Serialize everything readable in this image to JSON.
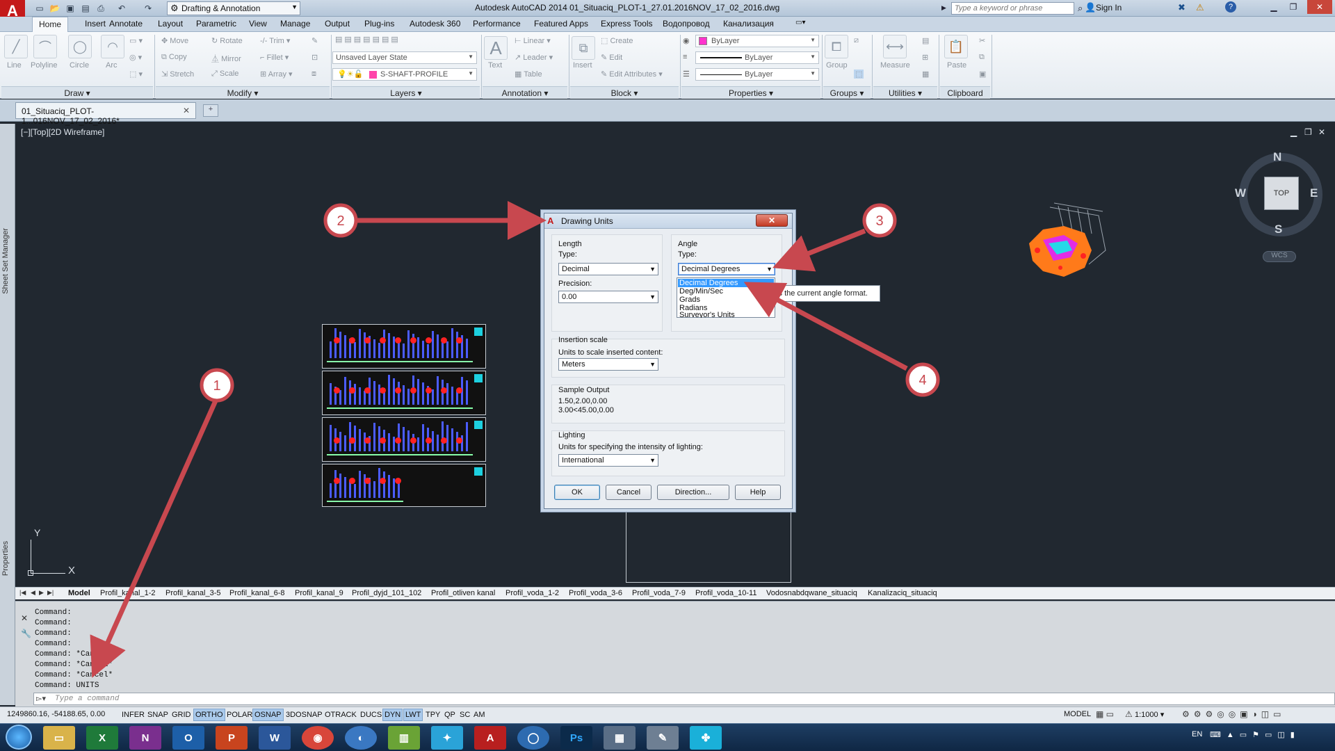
{
  "titlebar": {
    "workspace": "Drafting & Annotation",
    "title": "Autodesk AutoCAD 2014   01_Situaciq_PLOT-1_27.01.2016NOV_17_02_2016.dwg",
    "search_placeholder": "Type a keyword or phrase",
    "sign_in": "Sign In"
  },
  "ribbon_tabs": [
    "Home",
    "Insert",
    "Annotate",
    "Layout",
    "Parametric",
    "View",
    "Manage",
    "Output",
    "Plug-ins",
    "Autodesk 360",
    "Performance",
    "Featured Apps",
    "Express Tools",
    "Водопровод",
    "Канализация"
  ],
  "ribbon": {
    "draw": {
      "title": "Draw",
      "line": "Line",
      "polyline": "Polyline",
      "circle": "Circle",
      "arc": "Arc"
    },
    "modify": {
      "title": "Modify",
      "move": "Move",
      "rotate": "Rotate",
      "trim": "Trim",
      "copy": "Copy",
      "mirror": "Mirror",
      "fillet": "Fillet",
      "stretch": "Stretch",
      "scale": "Scale",
      "array": "Array"
    },
    "layers": {
      "title": "Layers",
      "layer_state": "Unsaved Layer State",
      "current_layer": "S-SHAFT-PROFILE"
    },
    "annotation": {
      "title": "Annotation",
      "text": "Text",
      "linear": "Linear",
      "leader": "Leader",
      "table": "Table"
    },
    "block": {
      "title": "Block",
      "insert": "Insert",
      "create": "Create",
      "edit": "Edit",
      "edit_attributes": "Edit Attributes"
    },
    "properties": {
      "title": "Properties",
      "color": "ByLayer",
      "lineweight": "ByLayer",
      "linetype": "ByLayer"
    },
    "groups": {
      "title": "Groups",
      "group": "Group"
    },
    "utilities": {
      "title": "Utilities",
      "measure": "Measure"
    },
    "clipboard": {
      "title": "Clipboard",
      "paste": "Paste"
    }
  },
  "document_tab": "01_Situaciq_PLOT-1...016NOV_17_02_2016*",
  "palettes": {
    "sheet_set": "Sheet Set Manager",
    "properties": "Properties"
  },
  "viewport": {
    "label": "[−][Top][2D Wireframe]"
  },
  "viewcube": {
    "n": "N",
    "s": "S",
    "e": "E",
    "w": "W",
    "top": "TOP",
    "wcs": "WCS"
  },
  "ucs": {
    "x": "X",
    "y": "Y"
  },
  "layout_tabs": [
    "Model",
    "Profil_kanal_1-2",
    "Profil_kanal_3-5",
    "Profil_kanal_6-8",
    "Profil_kanal_9",
    "Profil_dyjd_101_102",
    "Profil_otliven kanal",
    "Profil_voda_1-2",
    "Profil_voda_3-6",
    "Profil_voda_7-9",
    "Profil_voda_10-11",
    "Vodosnabdqwane_situaciq",
    "Kanalizaciq_situaciq"
  ],
  "command_history": [
    "Command:",
    "Command:",
    "Command:",
    "Command:",
    "Command: *Cancel*",
    "Command: *Cancel*",
    "Command: *Cancel*",
    "Command: UNITS"
  ],
  "command_placeholder": "Type a command",
  "status": {
    "coords": "1249860.16, -54188.65, 0.00",
    "toggles": [
      "INFER",
      "SNAP",
      "GRID",
      "ORTHO",
      "POLAR",
      "OSNAP",
      "3DOSNAP",
      "OTRACK",
      "DUCS",
      "DYN",
      "LWT",
      "TPY",
      "QP",
      "SC",
      "AM"
    ],
    "model": "MODEL",
    "scale": "1:1000"
  },
  "taskbar": {
    "lang": "EN"
  },
  "dialog": {
    "title": "Drawing Units",
    "length_label": "Length",
    "length_type_label": "Type:",
    "length_type": "Decimal",
    "precision_label": "Precision:",
    "precision": "0.00",
    "angle_label": "Angle",
    "angle_type_label": "Type:",
    "angle_type": "Decimal Degrees",
    "angle_options": [
      "Decimal Degrees",
      "Deg/Min/Sec",
      "Grads",
      "Radians",
      "Surveyor's Units"
    ],
    "insertion_label": "Insertion scale",
    "insertion_sub": "Units to scale inserted content:",
    "insertion_value": "Meters",
    "sample_label": "Sample Output",
    "sample_1": "1.50,2.00,0.00",
    "sample_2": "3.00<45.00,0.00",
    "lighting_label": "Lighting",
    "lighting_sub": "Units for specifying the intensity of lighting:",
    "lighting_value": "International",
    "ok": "OK",
    "cancel": "Cancel",
    "direction": "Direction...",
    "help": "Help",
    "tooltip": "Sets the current angle format."
  },
  "annotations": {
    "c1": "1",
    "c2": "2",
    "c3": "3",
    "c4": "4",
    "accent": "#c8484f"
  }
}
